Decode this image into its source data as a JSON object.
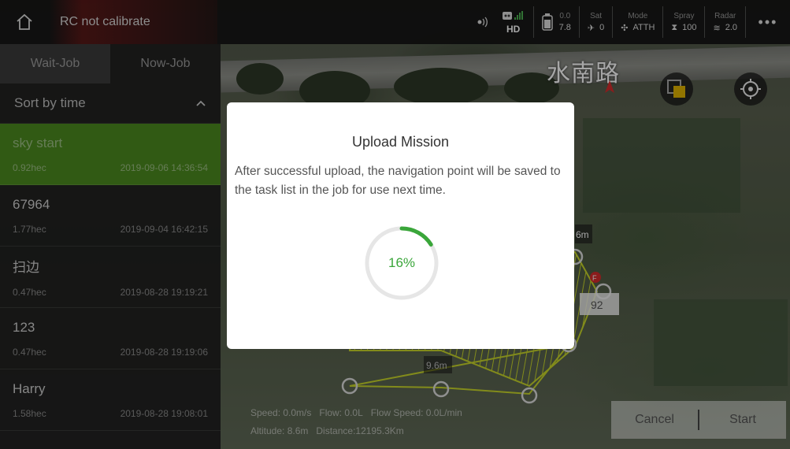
{
  "topbar": {
    "rc_status": "RC not calibrate",
    "link": {
      "label": "HD"
    },
    "battery": {
      "top": "0.0",
      "bottom": "7.8"
    },
    "sat": {
      "label": "Sat",
      "value": "0"
    },
    "mode": {
      "label": "Mode",
      "value": "ATTH"
    },
    "spray": {
      "label": "Spray",
      "value": "100"
    },
    "radar": {
      "label": "Radar",
      "value": "2.0"
    }
  },
  "left_panel": {
    "tabs": [
      {
        "label": "Wait-Job"
      },
      {
        "label": "Now-Job"
      }
    ],
    "sort_label": "Sort by time",
    "jobs": [
      {
        "name": "sky start",
        "area": "0.92hec",
        "date": "2019-09-06 14:36:54"
      },
      {
        "name": "67964",
        "area": "1.77hec",
        "date": "2019-09-04 16:42:15"
      },
      {
        "name": "扫边",
        "area": "0.47hec",
        "date": "2019-08-28 19:19:21"
      },
      {
        "name": "123",
        "area": "0.47hec",
        "date": "2019-08-28 19:19:06"
      },
      {
        "name": "Harry",
        "area": "1.58hec",
        "date": "2019-08-28 19:08:01"
      }
    ]
  },
  "map": {
    "road_label": "水南路",
    "dist_label": "92",
    "seg_label": "9.6m",
    "partial_label": "6m",
    "waypoint_badge": "F"
  },
  "telemetry": {
    "speed": "Speed:  0.0m/s",
    "flow": "Flow:  0.0L",
    "flow_speed": "Flow Speed:  0.0L/min",
    "altitude": "Altitude:  8.6m",
    "distance": "Distance:12195.3Km"
  },
  "actions": {
    "cancel": "Cancel",
    "start": "Start"
  },
  "modal": {
    "title": "Upload Mission",
    "message": "After successful upload, the navigation point will be saved to the task list in the job for use next time.",
    "progress_text": "16%",
    "progress_value": 0.16
  },
  "colors": {
    "accent": "#4c8a1f",
    "progress": "#3aa63a",
    "alert": "#d62b2b",
    "mission_line": "#c8d62a"
  }
}
